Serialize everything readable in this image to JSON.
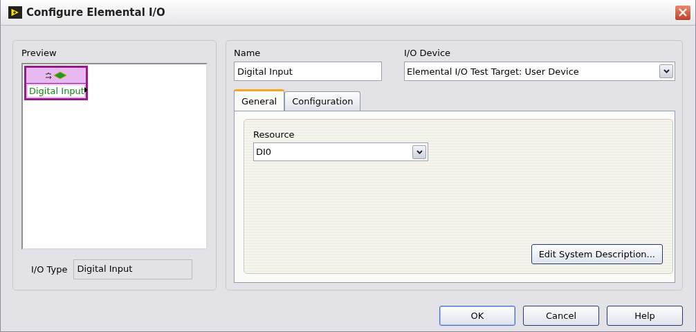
{
  "window": {
    "title": "Configure Elemental I/O"
  },
  "preview": {
    "label": "Preview",
    "node_label": "Digital Input",
    "io_type_label": "I/O Type",
    "io_type_value": "Digital Input"
  },
  "name": {
    "label": "Name",
    "value": "Digital Input"
  },
  "io_device": {
    "label": "I/O Device",
    "value": "Elemental I/O Test Target: User Device"
  },
  "tabs": [
    {
      "label": "General",
      "selected": true
    },
    {
      "label": "Configuration",
      "selected": false
    }
  ],
  "resource": {
    "label": "Resource",
    "value": "DI0"
  },
  "edit_button": "Edit System Description...",
  "buttons": [
    "OK",
    "Cancel",
    "Help"
  ]
}
